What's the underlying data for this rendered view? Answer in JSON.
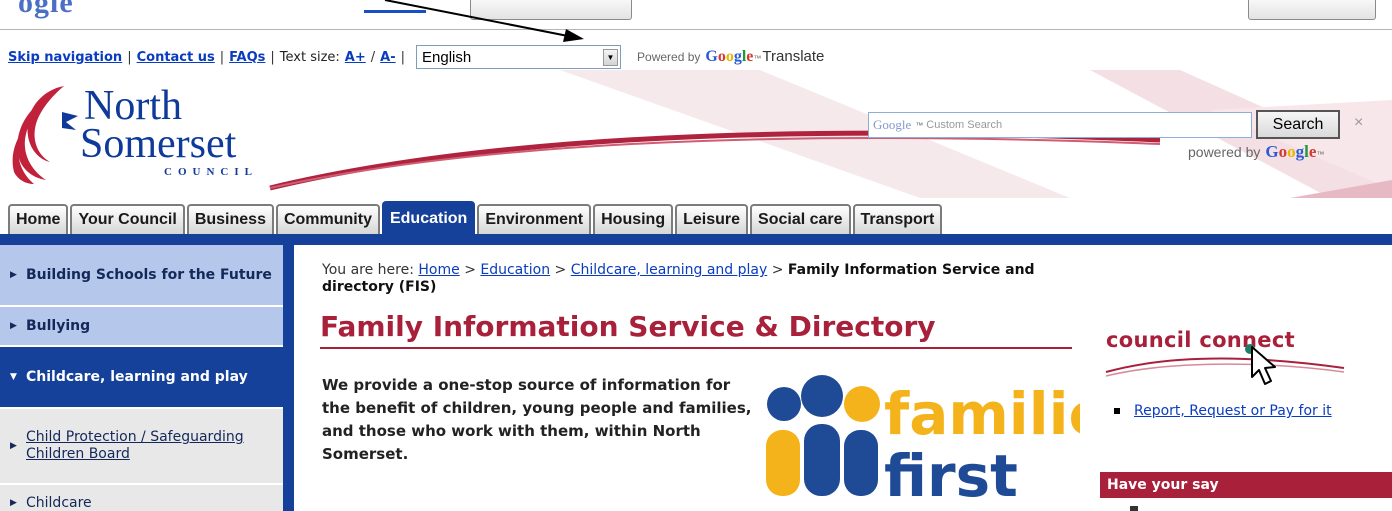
{
  "top": {
    "logo_fragment": "ogle"
  },
  "utility": {
    "skip_label": "Skip navigation",
    "contact_label": "Contact us",
    "faqs_label": "FAQs",
    "text_size_label": "Text size:",
    "text_larger_label": "A+",
    "text_smaller_label": "A-",
    "language_value": "English",
    "powered_by_label": "Powered by",
    "translate_label": "Translate"
  },
  "header": {
    "logo_line1": "North",
    "logo_line2": "Somerset",
    "logo_line3": "COUNCIL",
    "search_placeholder_brand": "Google",
    "search_placeholder": "Custom Search",
    "search_button_label": "Search",
    "search_clear_label": "×",
    "powered_by_label": "powered by"
  },
  "tabs": [
    {
      "label": "Home"
    },
    {
      "label": "Your Council"
    },
    {
      "label": "Business"
    },
    {
      "label": "Community"
    },
    {
      "label": "Education"
    },
    {
      "label": "Environment"
    },
    {
      "label": "Housing"
    },
    {
      "label": "Leisure"
    },
    {
      "label": "Social care"
    },
    {
      "label": "Transport"
    }
  ],
  "active_tab": "Education",
  "left_nav": [
    {
      "label": "Building Schools for the Future"
    },
    {
      "label": "Bullying"
    },
    {
      "label": "Childcare, learning and play"
    },
    {
      "label": "Child Protection / Safeguarding Children Board"
    },
    {
      "label": "Childcare"
    }
  ],
  "breadcrumb": {
    "prefix": "You are here:",
    "home": "Home",
    "education": "Education",
    "childcare": "Childcare, learning and play",
    "current": "Family Information Service and directory (FIS)"
  },
  "main": {
    "title": "Family Information Service & Directory",
    "intro": "We provide a one-stop source of information for the benefit of children, young people and families, and those who work with them, within North Somerset.",
    "ff_word1": "families",
    "ff_word2": "first"
  },
  "right_sidebar": {
    "council_connect": "council connect",
    "link_label": "Report, Request or Pay for it",
    "have_your_say": "Have your say"
  },
  "colors": {
    "navy": "#15419a",
    "crimson": "#a8203a",
    "link": "#0a3cbf",
    "ff_yellow": "#f5b31b",
    "ff_blue": "#1e4a96"
  }
}
